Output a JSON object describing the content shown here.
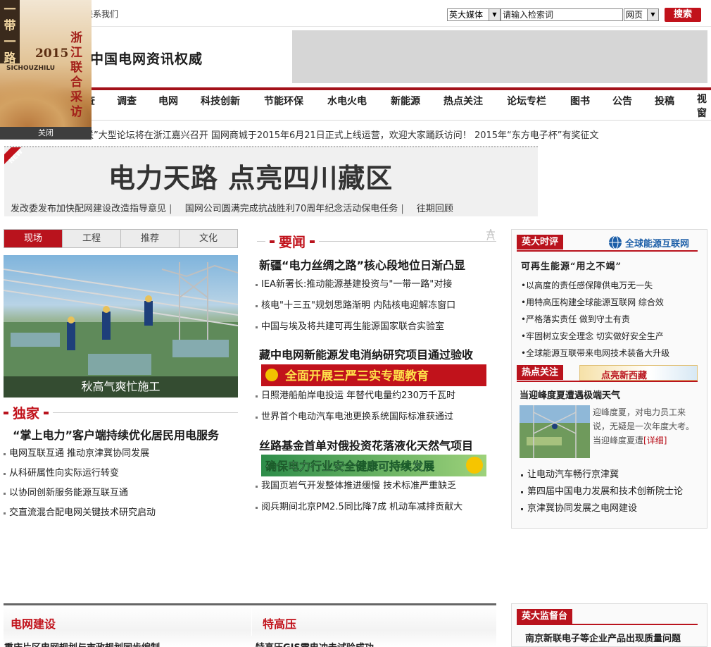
{
  "top": {
    "contact": "联系我们",
    "search_scope": "英大媒体",
    "search_placeholder": "请输入检索词",
    "search_type": "网页",
    "search_button": "搜索"
  },
  "header": {
    "slogan": "中国电网资讯权威"
  },
  "float_ad": {
    "band_text": "一带一路",
    "year": "2015",
    "pinyin": "SICHOUZHILU",
    "vertical_text": "浙江联合采访",
    "close_label": "关闭"
  },
  "nav": {
    "items": [
      "查",
      "调查",
      "电网",
      "科技创新",
      "节能环保",
      "水电火电",
      "新能源",
      "热点关注",
      "论坛专栏",
      "图书",
      "公告",
      "投稿",
      "视窗"
    ]
  },
  "ticker": {
    "items": [
      "联”大型论坛将在浙江嘉兴召开",
      "国网商城于2015年6月21日正式上线运营，欢迎大家踊跃访问！",
      "2015年“东方电子杯”有奖征文"
    ]
  },
  "banner": {
    "badge": "NEW",
    "headline": "电力天路 点亮四川藏区",
    "links": [
      "发改委发布加快配网建设改造指导意见",
      "国网公司圆满完成抗战胜利70周年纪念活动保电任务",
      "往期回顾"
    ],
    "separator": "|"
  },
  "left": {
    "tabs": [
      "现场",
      "工程",
      "推荐",
      "文化"
    ],
    "active_tab": 0,
    "photo_caption": "秋高气爽忙施工",
    "exclusive_title": "独家",
    "exclusive_lead": "“掌上电力”客户端持续优化居民用电服务",
    "exclusive_list": [
      "电网互联互通 推动京津冀协同发展",
      "从科研属性向实际运行转变",
      "以协同创新服务能源互联互通",
      "交直流混合配电网关键技术研究启动"
    ]
  },
  "middle": {
    "news_title": "要闻",
    "blocks": [
      {
        "lead": "新疆“电力丝绸之路”核心段地位日渐凸显",
        "items": [
          "IEA新署长:推动能源基建投资与\"一带一路\"对接",
          "核电\"十三五\"规划思路渐明 内陆核电迎解冻窗口",
          "中国与埃及将共建可再生能源国家联合实验室"
        ]
      },
      {
        "lead": "藏中电网新能源发电消纳研究项目通过验收",
        "promo": "全面开展三严三实专题教育",
        "items": [
          "日照港船舶岸电投运 年替代电量约230万千瓦时",
          "世界首个电动汽车电池更换系统国际标准获通过"
        ]
      },
      {
        "lead": "丝路基金首单对俄投资花落液化天然气项目",
        "promo": "确保电力行业安全健康可持续发展",
        "items": [
          "我国页岩气开发整体推进缓慢 技术标准严重缺乏",
          "阅兵期间北京PM2.5同比降7成 机动车减排贡献大"
        ]
      }
    ]
  },
  "right": {
    "commentary_label": "英大时评",
    "commentary_logo": "全球能源互联网",
    "commentary_lead": "可再生能源“用之不竭”",
    "commentary_items": [
      "•以高度的责任感保障供电万无一失",
      "•用特高压构建全球能源互联网 综合效",
      "•严格落实责任 做到守土有责",
      "•牢固树立安全理念 切实做好安全生产",
      "•全球能源互联带来电网技术装备大升级"
    ],
    "hot_label": "热点关注",
    "hot_banner": "点亮新西藏",
    "hot_lead": "当迎峰度夏遭遇极端天气",
    "hot_summary": "迎峰度夏，对电力员工来说，无疑是一次年度大考。当迎峰度夏遭",
    "hot_more": "[详细]",
    "hot_items": [
      "让电动汽车畅行京津冀",
      "第四届中国电力发展和技术创新院士论",
      "京津冀协同发展之电网建设"
    ],
    "supervision_label": "英大监督台",
    "supervision_lead": "南京新联电子等企业产品出现质量问题"
  },
  "bottom": {
    "grid_title": "电网建设",
    "grid_sub": "重庆片区电网规划与市政规划同步编制",
    "uhv_title": "特高压",
    "uhv_sub": "特高压GIS雷电冲击试验成功"
  },
  "colors": {
    "brand_red": "#b9131d",
    "nav_rule": "#a31119"
  }
}
